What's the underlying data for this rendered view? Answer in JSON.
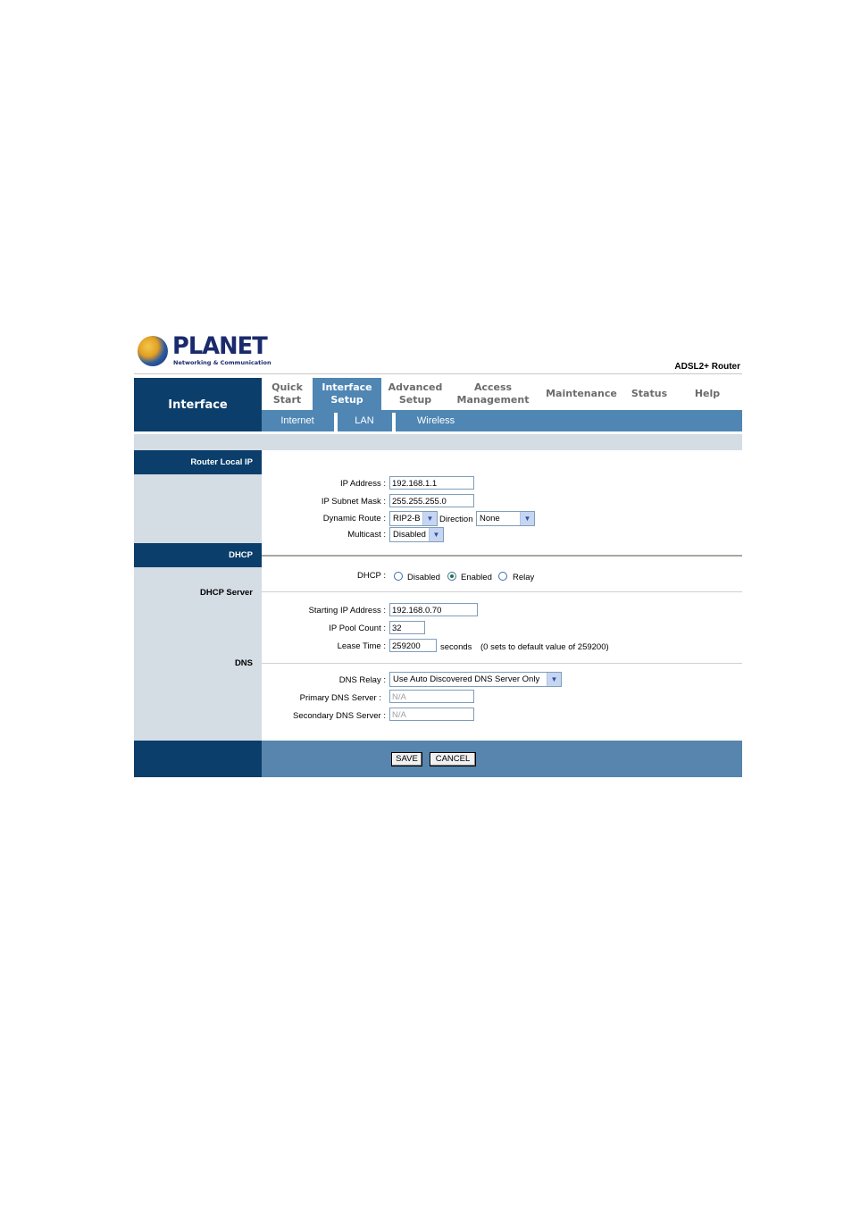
{
  "brand": {
    "name": "PLANET",
    "tagline": "Networking & Communication",
    "product": "ADSL2+ Router"
  },
  "nav": {
    "section_title": "Interface",
    "tabs": [
      {
        "label": "Quick\nStart"
      },
      {
        "label": "Interface\nSetup"
      },
      {
        "label": "Advanced\nSetup"
      },
      {
        "label": "Access\nManagement"
      },
      {
        "label": "Maintenance"
      },
      {
        "label": "Status"
      },
      {
        "label": "Help"
      }
    ],
    "subtabs": [
      "Internet",
      "LAN",
      "Wireless"
    ]
  },
  "sections": {
    "router_local_ip": "Router Local IP",
    "dhcp": "DHCP",
    "dhcp_server": "DHCP Server",
    "dns": "DNS"
  },
  "lan": {
    "ip_address_label": "IP Address :",
    "ip_address": "192.168.1.1",
    "subnet_mask_label": "IP Subnet Mask :",
    "subnet_mask": "255.255.255.0",
    "dynamic_route_label": "Dynamic Route :",
    "dynamic_route": "RIP2-B",
    "direction_label": "Direction",
    "direction": "None",
    "multicast_label": "Multicast :",
    "multicast": "Disabled"
  },
  "dhcp": {
    "label": "DHCP :",
    "options": [
      "Disabled",
      "Enabled",
      "Relay"
    ],
    "selected": "Enabled",
    "start_ip_label": "Starting IP Address :",
    "start_ip": "192.168.0.70",
    "pool_count_label": "IP Pool Count :",
    "pool_count": "32",
    "lease_time_label": "Lease Time :",
    "lease_time": "259200",
    "lease_unit": "seconds",
    "lease_note": "(0 sets to default value of 259200)"
  },
  "dns": {
    "relay_label": "DNS Relay :",
    "relay": "Use Auto Discovered DNS Server Only",
    "primary_label": "Primary DNS Server :",
    "primary": "N/A",
    "secondary_label": "Secondary DNS Server :",
    "secondary": "N/A"
  },
  "actions": {
    "save": "SAVE",
    "cancel": "CANCEL"
  },
  "colors": {
    "nav_dark": "#0b3e6b",
    "nav_light": "#4f86b4",
    "panel": "#d4dce4"
  },
  "icons": {
    "logo": "planet-globe-logo",
    "dropdown": "chevron-down-icon"
  }
}
